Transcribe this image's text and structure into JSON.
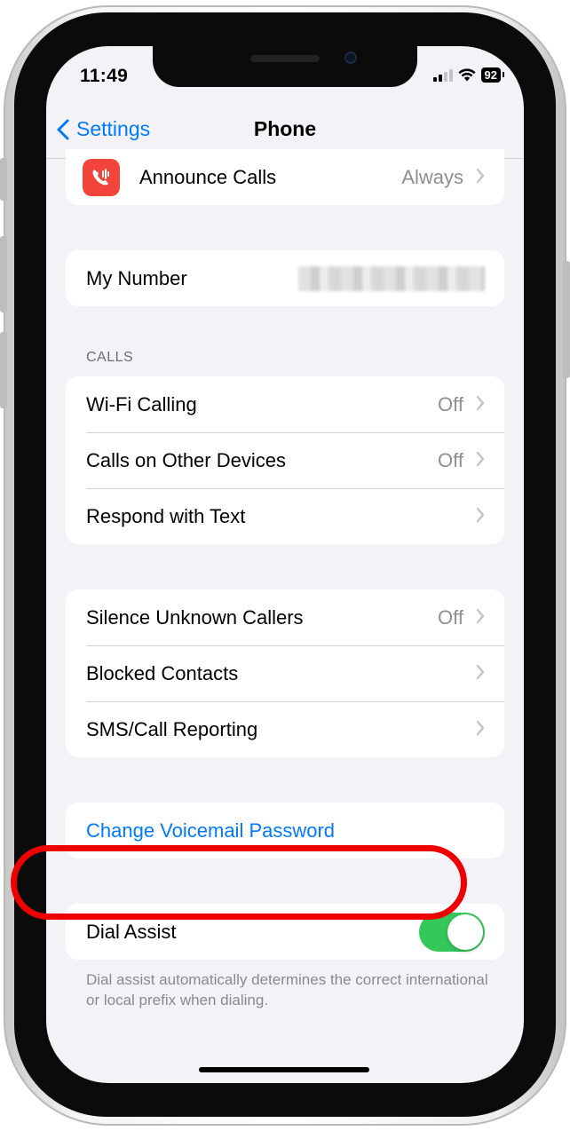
{
  "status_bar": {
    "time": "11:49",
    "battery": "92"
  },
  "nav": {
    "back_label": "Settings",
    "title": "Phone"
  },
  "announce": {
    "label": "Announce Calls",
    "value": "Always"
  },
  "my_number": {
    "label": "My Number"
  },
  "calls": {
    "header": "CALLS",
    "items": [
      {
        "label": "Wi-Fi Calling",
        "value": "Off"
      },
      {
        "label": "Calls on Other Devices",
        "value": "Off"
      },
      {
        "label": "Respond with Text",
        "value": ""
      }
    ]
  },
  "privacy": {
    "items": [
      {
        "label": "Silence Unknown Callers",
        "value": "Off"
      },
      {
        "label": "Blocked Contacts",
        "value": ""
      },
      {
        "label": "SMS/Call Reporting",
        "value": ""
      }
    ]
  },
  "voicemail": {
    "label": "Change Voicemail Password"
  },
  "dial_assist": {
    "label": "Dial Assist",
    "enabled": true,
    "footer": "Dial assist automatically determines the correct international or local prefix when dialing."
  },
  "colors": {
    "accent": "#007aff",
    "toggle_on": "#34c759",
    "highlight": "#ee0000",
    "announce_icon": "#f2443a"
  }
}
